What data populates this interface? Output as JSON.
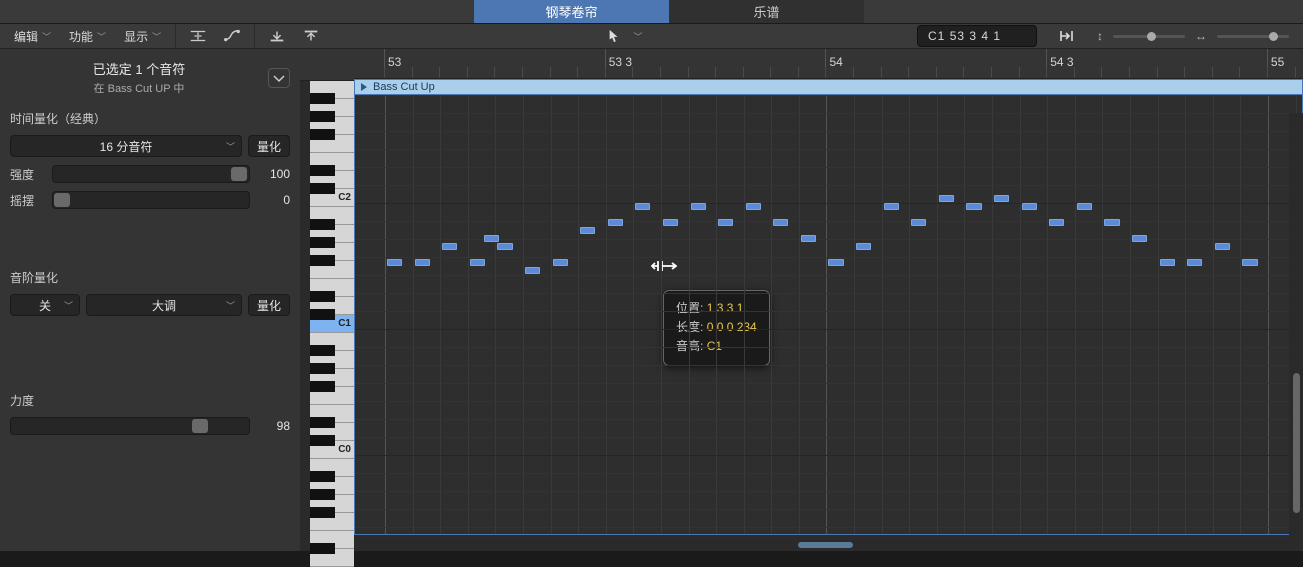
{
  "tabs": {
    "pianoRoll": "钢琴卷帘",
    "score": "乐谱"
  },
  "toolbar": {
    "edit": "编辑",
    "functions": "功能",
    "view": "显示",
    "infoDisplay": "C1  53 3 4 1"
  },
  "panel": {
    "selectedTitle": "已选定 1 个音符",
    "selectedSub": "在 Bass Cut UP 中",
    "timeQuantizeLabel": "时间量化（经典）",
    "timeQuantizeValue": "16 分音符",
    "quantizeBtn": "量化",
    "strengthLabel": "强度",
    "strengthValue": "100",
    "swingLabel": "摇摆",
    "swingValue": "0",
    "scaleQuantizeLabel": "音阶量化",
    "scaleRoot": "关",
    "scaleType": "大调",
    "velocityLabel": "力度",
    "velocityValue": "98"
  },
  "keyboard": {
    "c0": "C0",
    "c1": "C1",
    "c2": "C2"
  },
  "ruler": {
    "b53": "53",
    "b533": "53 3",
    "b54": "54",
    "b543": "54 3",
    "b55": "55"
  },
  "region": {
    "name": "Bass Cut Up"
  },
  "tooltip": {
    "posLabel": "位置:",
    "posValue": "1 3 3 1",
    "lenLabel": "长度:",
    "lenValue": "0 0 0 234",
    "pitchLabel": "音高:",
    "pitchValue": "C1"
  }
}
